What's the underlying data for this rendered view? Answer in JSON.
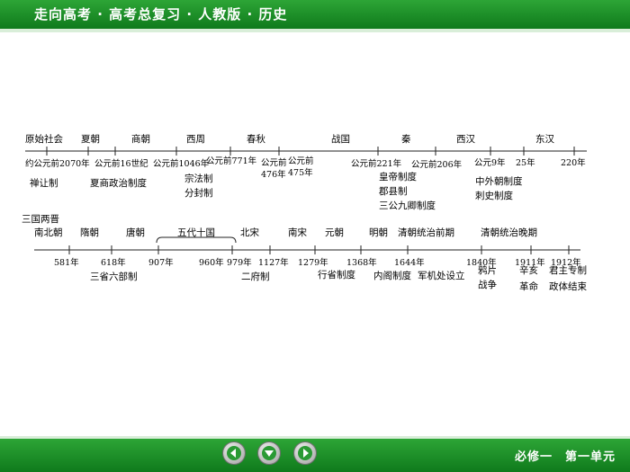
{
  "header": {
    "title": "走向高考 · 高考总复习 · 人教版 · 历史"
  },
  "footer": {
    "text": "必修一　第一单元"
  },
  "nav": {
    "prev_icon": "arrow-left",
    "home_icon": "arrow-down",
    "next_icon": "arrow-right"
  },
  "colors": {
    "bar_green": "#1f8f2a",
    "strip_light": "#d9eed9"
  },
  "timeline1": {
    "eras": [
      "原始社会",
      "夏朝",
      "商朝",
      "西周",
      "春秋",
      "战国",
      "秦",
      "西汉",
      "东汉"
    ],
    "dates": [
      "约公元前2070年",
      "公元前16世纪",
      "公元前1046年",
      "公元前771年",
      "公元前",
      "476年",
      "公元前",
      "475年",
      "公元前221年",
      "公元前206年",
      "公元9年",
      "25年",
      "220年"
    ],
    "institutions": [
      "禅让制",
      "夏商政治制度",
      "宗法制",
      "分封制",
      "皇帝制度",
      "郡县制",
      "三公九卿制度",
      "中外朝制度",
      "刺史制度"
    ]
  },
  "timeline2": {
    "eras": [
      "三国两晋",
      "南北朝",
      "隋朝",
      "唐朝",
      "五代十国",
      "北宋",
      "南宋",
      "元朝",
      "明朝",
      "清朝统治前期",
      "清朝统治晚期"
    ],
    "dates": [
      "581年",
      "618年",
      "907年",
      "960年",
      "979年",
      "1127年",
      "1279年",
      "1368年",
      "1644年",
      "1840年",
      "1911年",
      "1912年"
    ],
    "institutions": [
      "三省六部制",
      "二府制",
      "行省制度",
      "内阁制度",
      "军机处设立",
      "鸦片",
      "战争",
      "辛亥",
      "革命",
      "君主专制",
      "政体结束"
    ]
  }
}
